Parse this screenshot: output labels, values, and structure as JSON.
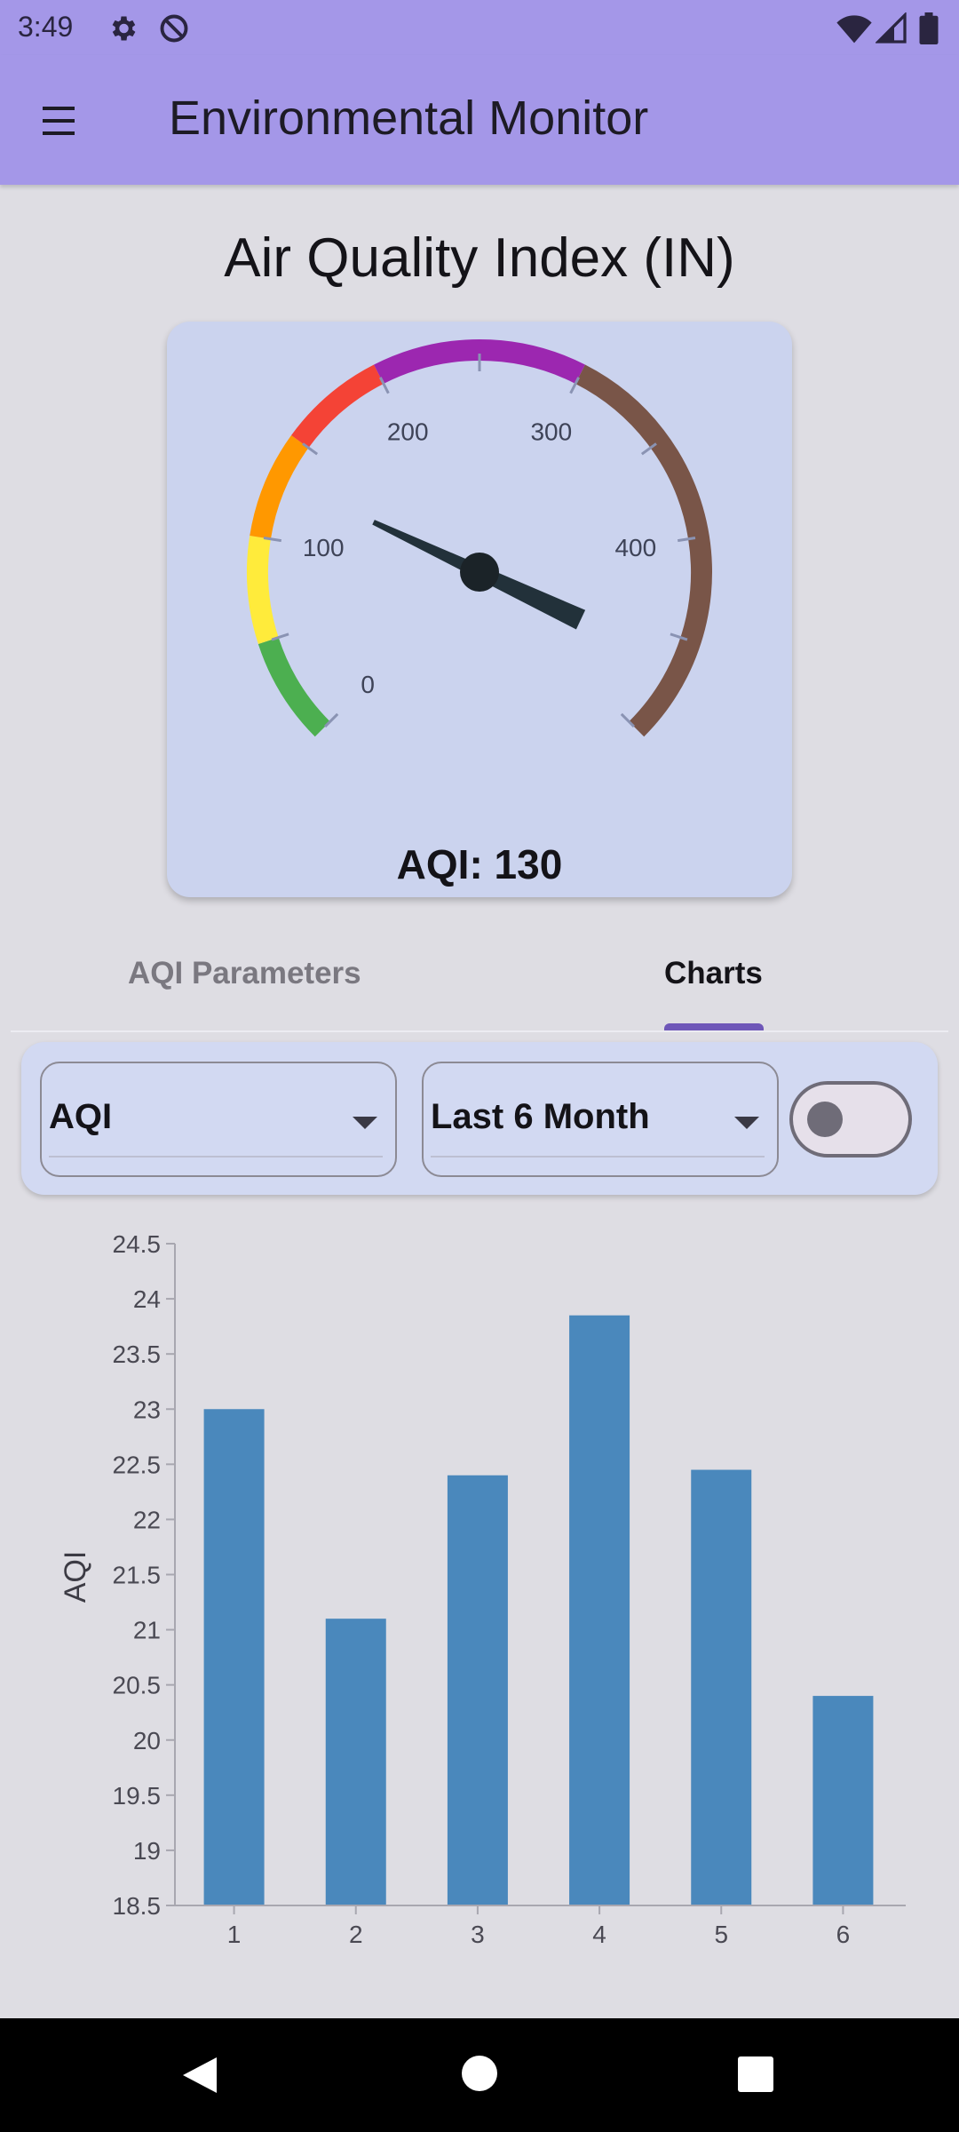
{
  "status_bar": {
    "time": "3:49",
    "icons": [
      "gear-icon",
      "no-disturb-icon",
      "wifi-icon",
      "signal-icon",
      "battery-icon"
    ]
  },
  "app_bar": {
    "title": "Environmental Monitor",
    "menu_icon": "hamburger-menu-icon",
    "background": "#a497e8"
  },
  "gauge": {
    "title": "Air Quality Index (IN)",
    "min": 0,
    "max": 500,
    "value": 130,
    "value_label": "AQI: 130",
    "tick_labels": [
      "0",
      "100",
      "200",
      "300",
      "400"
    ],
    "bands": [
      {
        "from": 0,
        "to": 50,
        "color": "#4caf50"
      },
      {
        "from": 50,
        "to": 100,
        "color": "#ffeb3b"
      },
      {
        "from": 100,
        "to": 150,
        "color": "#ff9800"
      },
      {
        "from": 150,
        "to": 200,
        "color": "#f44336"
      },
      {
        "from": 200,
        "to": 300,
        "color": "#9c27b0"
      },
      {
        "from": 300,
        "to": 500,
        "color": "#795548"
      }
    ]
  },
  "tabs": [
    {
      "label": "AQI Parameters",
      "selected": false
    },
    {
      "label": "Charts",
      "selected": true
    }
  ],
  "filters": {
    "parameter": "AQI",
    "period": "Last 6 Month",
    "toggle_on": false
  },
  "chart_data": {
    "type": "bar",
    "categories": [
      "1",
      "2",
      "3",
      "4",
      "5",
      "6"
    ],
    "values": [
      23.0,
      21.1,
      22.4,
      23.85,
      22.45,
      20.4
    ],
    "xlabel": "",
    "ylabel": "AQI",
    "ylim": [
      18.5,
      24.5
    ],
    "yticks": [
      "18.5",
      "19",
      "19.5",
      "20",
      "20.5",
      "21",
      "21.5",
      "22",
      "22.5",
      "23",
      "23.5",
      "24",
      "24.5"
    ],
    "bar_color": "#4a88bc",
    "grid": false
  },
  "nav_bar": {
    "icons": [
      "back-icon",
      "home-icon",
      "recents-icon"
    ]
  }
}
